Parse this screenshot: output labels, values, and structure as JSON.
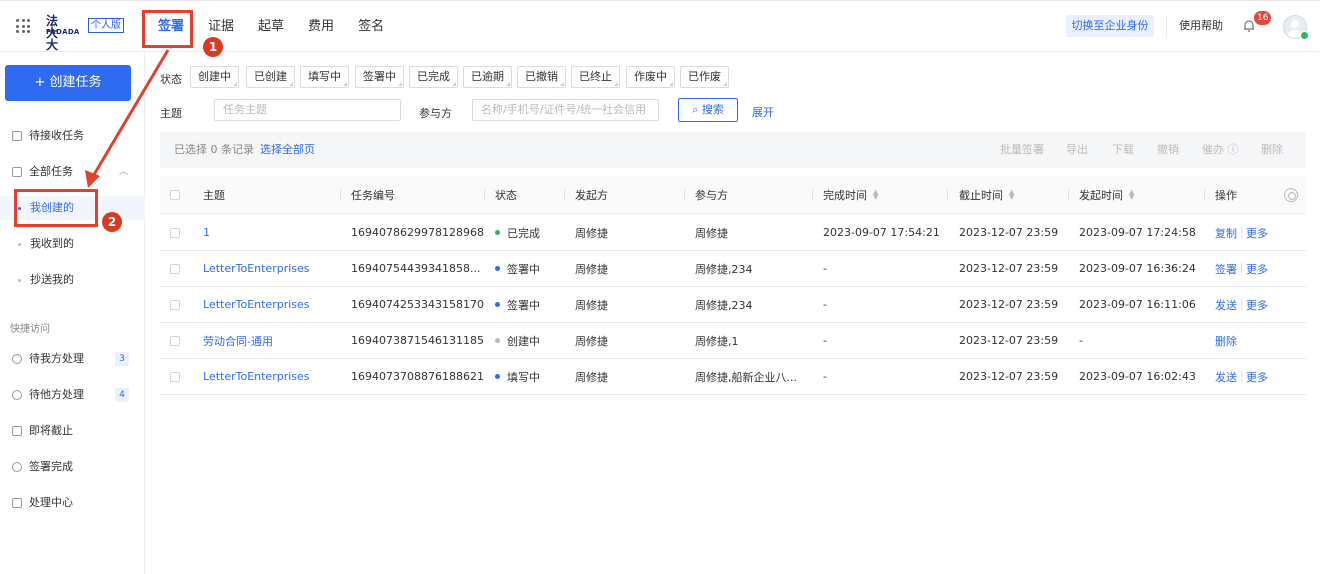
{
  "header": {
    "logo_cn": "法大大",
    "logo_en": "FADADA",
    "logo_tag": "个人版",
    "nav": [
      "签署",
      "证据",
      "起草",
      "费用",
      "签名"
    ],
    "switch_label": "切换至企业身份",
    "help_label": "使用帮助",
    "notif_count": "16"
  },
  "annotations": [
    "1",
    "2"
  ],
  "sidebar": {
    "create_label": "+ 创建任务",
    "pending_receive": "待接收任务",
    "all_tasks": "全部任务",
    "sub_items": [
      "我创建的",
      "我收到的",
      "抄送我的"
    ],
    "quick_access": "快捷访问",
    "quick_items": [
      {
        "label": "待我方处理",
        "count": "3"
      },
      {
        "label": "待他方处理",
        "count": "4"
      },
      {
        "label": "即将截止"
      },
      {
        "label": "签署完成"
      },
      {
        "label": "处理中心"
      }
    ]
  },
  "filters": {
    "status_label": "状态",
    "statuses": [
      "创建中",
      "已创建",
      "填写中",
      "签署中",
      "已完成",
      "已逾期",
      "已撤销",
      "已终止",
      "作废中",
      "已作废"
    ],
    "subject_label": "主题",
    "subject_placeholder": "任务主题",
    "party_label": "参与方",
    "party_placeholder": "名称/手机号/证件号/统一社会信用",
    "search_label": "搜索",
    "expand_label": "展开"
  },
  "action_bar": {
    "selected": "已选择 0 条记录",
    "select_all": "选择全部页",
    "actions": [
      "批量签署",
      "导出",
      "下载",
      "撤销",
      "催办",
      "删除"
    ]
  },
  "table": {
    "headers": [
      "主题",
      "任务编号",
      "状态",
      "发起方",
      "参与方",
      "完成时间",
      "截止时间",
      "发起时间",
      "操作"
    ],
    "rows": [
      {
        "subject": "1",
        "id": "1694078629978128968",
        "status": "已完成",
        "status_color": "#31b36b",
        "initiator": "周修捷",
        "parties": "周修捷",
        "done": "2023-09-07 17:54:21",
        "deadline": "2023-12-07 23:59",
        "started": "2023-09-07 17:24:58",
        "ops": [
          "复制",
          "更多"
        ]
      },
      {
        "subject": "LetterToEnterprises",
        "id": "1694075443934185​8...",
        "status": "签署中",
        "status_color": "#2f6bf0",
        "initiator": "周修捷",
        "parties": "周修捷,234",
        "done": "-",
        "deadline": "2023-12-07 23:59",
        "started": "2023-09-07 16:36:24",
        "ops": [
          "签署",
          "更多"
        ]
      },
      {
        "subject": "LetterToEnterprises",
        "id": "1694074253343158170",
        "status": "签署中",
        "status_color": "#2f6bf0",
        "initiator": "周修捷",
        "parties": "周修捷,234",
        "done": "-",
        "deadline": "2023-12-07 23:59",
        "started": "2023-09-07 16:11:06",
        "ops": [
          "发送",
          "更多"
        ]
      },
      {
        "subject": "劳动合同-通用",
        "id": "1694073871546131185",
        "status": "创建中",
        "status_color": "#bbbbbb",
        "initiator": "周修捷",
        "parties": "周修捷,1",
        "done": "-",
        "deadline": "2023-12-07 23:59",
        "started": "-",
        "ops": [
          "删除"
        ]
      },
      {
        "subject": "LetterToEnterprises",
        "id": "1694073708876188621",
        "status": "填写中",
        "status_color": "#2f6bf0",
        "initiator": "周修捷",
        "parties": "周修捷,船新企业八...",
        "done": "-",
        "deadline": "2023-12-07 23:59",
        "started": "2023-09-07 16:02:43",
        "ops": [
          "发送",
          "更多"
        ]
      }
    ]
  },
  "colors": {
    "accent": "#2f6bf0",
    "annotation": "#e2412b"
  }
}
